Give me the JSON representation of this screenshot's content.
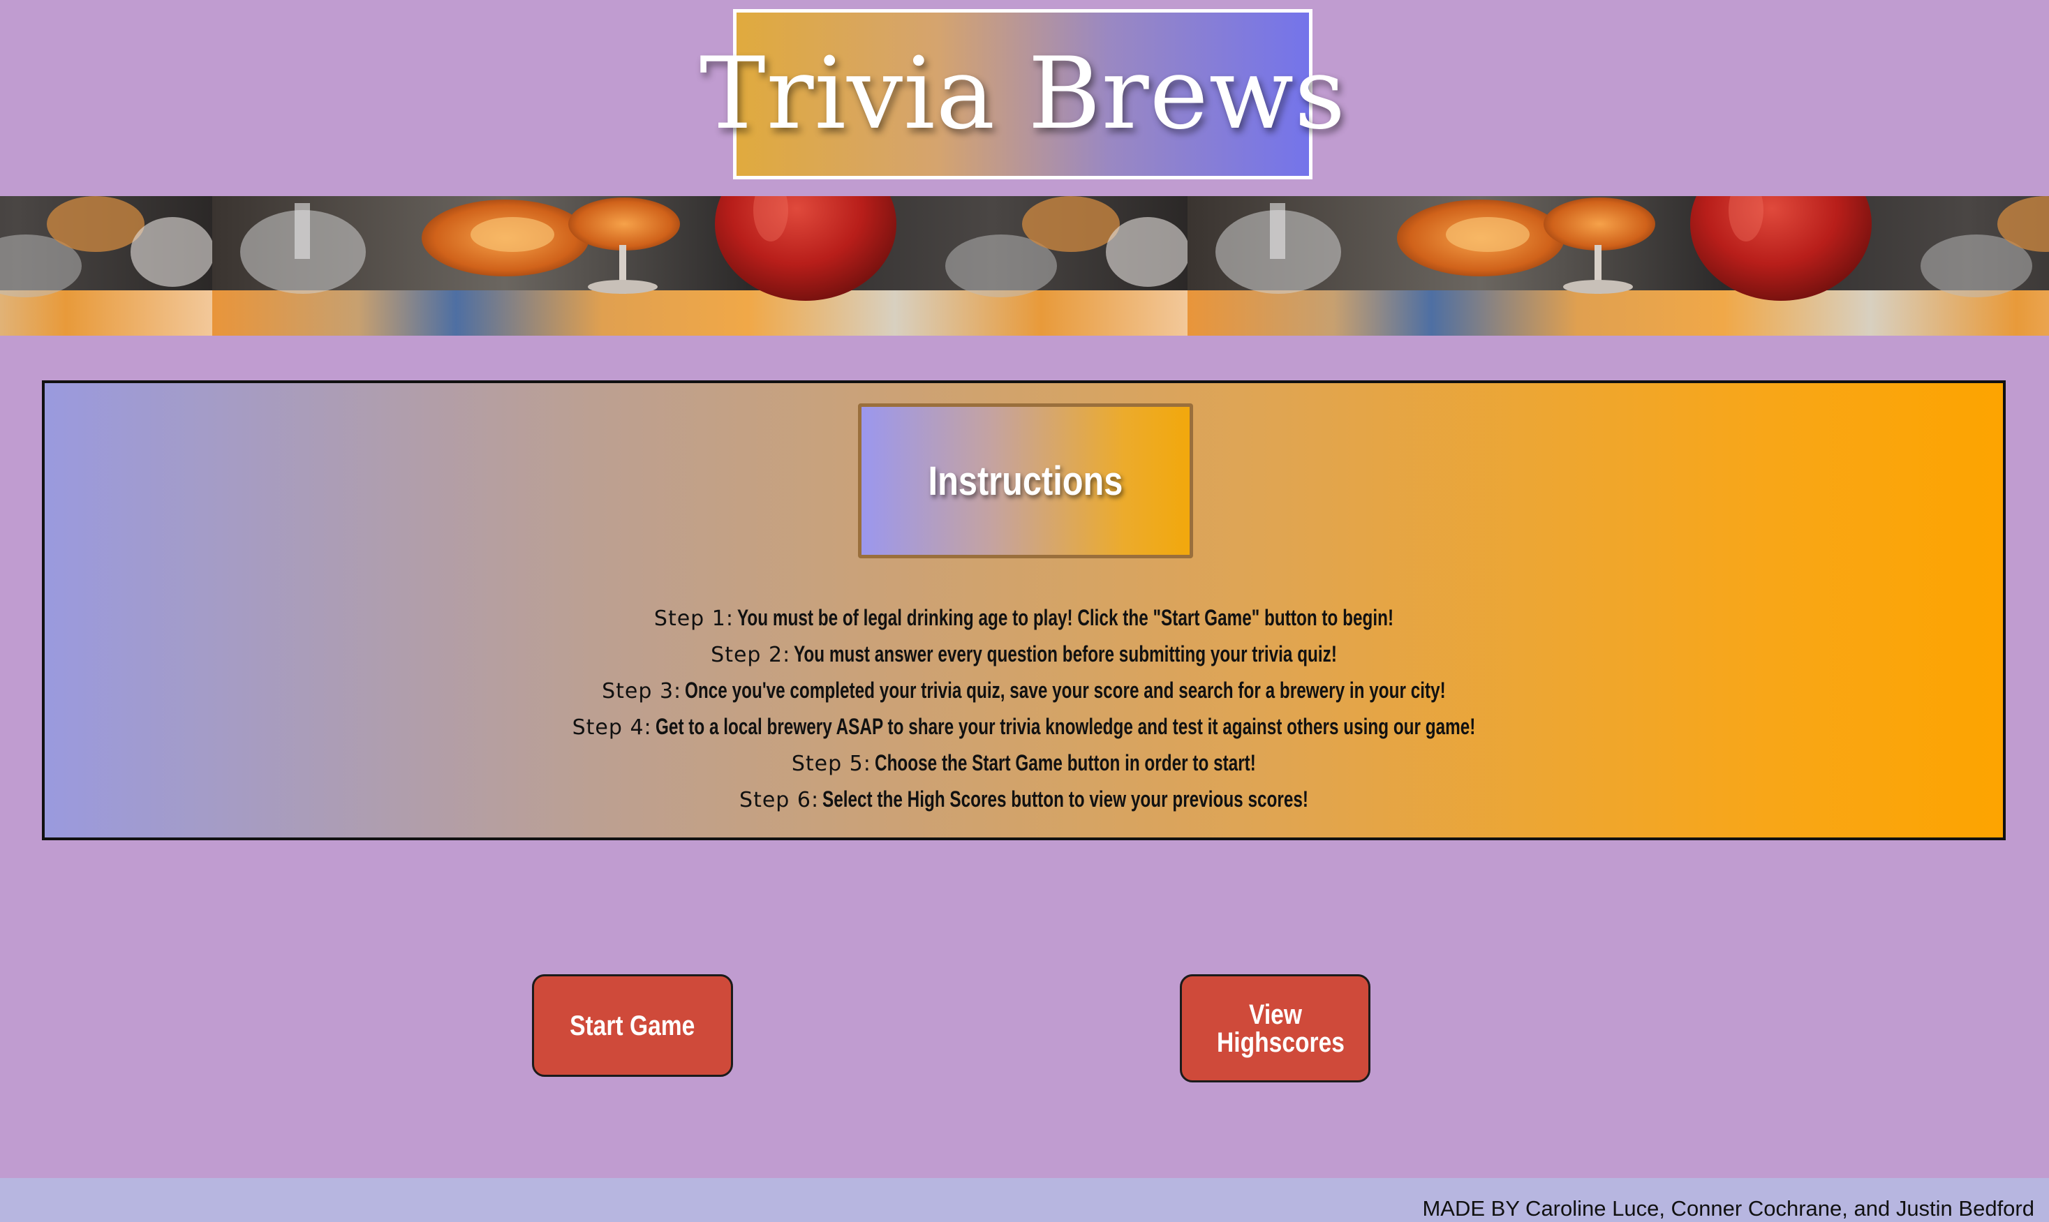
{
  "header": {
    "title": "Trivia Brews"
  },
  "banner": {
    "image_description": "beer-glasses-photo-strip"
  },
  "instructions": {
    "heading": "Instructions",
    "steps": [
      {
        "label": "Step 1:",
        "text": "You must be of legal drinking age to play! Click the \"Start Game\" button to begin!"
      },
      {
        "label": "Step 2:",
        "text": "You must answer every question before submitting your trivia quiz!"
      },
      {
        "label": "Step 3:",
        "text": "Once you've completed your trivia quiz, save your score and search for a brewery in your city!"
      },
      {
        "label": "Step 4:",
        "text": "Get to a local brewery ASAP to share your trivia knowledge and test it against others using our game!"
      },
      {
        "label": "Step 5:",
        "text": "Choose the Start Game button in order to start!"
      },
      {
        "label": "Step 6:",
        "text": "Select the High Scores button to view your previous scores!"
      }
    ]
  },
  "buttons": {
    "start_game": "Start Game",
    "view_highscores": "View Highscores"
  },
  "footer": {
    "credits": "MADE BY Caroline Luce, Conner Cochrane, and Justin Bedford"
  },
  "colors": {
    "page_background": "#c09cd0",
    "button_background": "#cf4a3a",
    "footer_background": "#b7b6e0",
    "accent_orange": "#fda400",
    "accent_blue": "#7474ea"
  }
}
